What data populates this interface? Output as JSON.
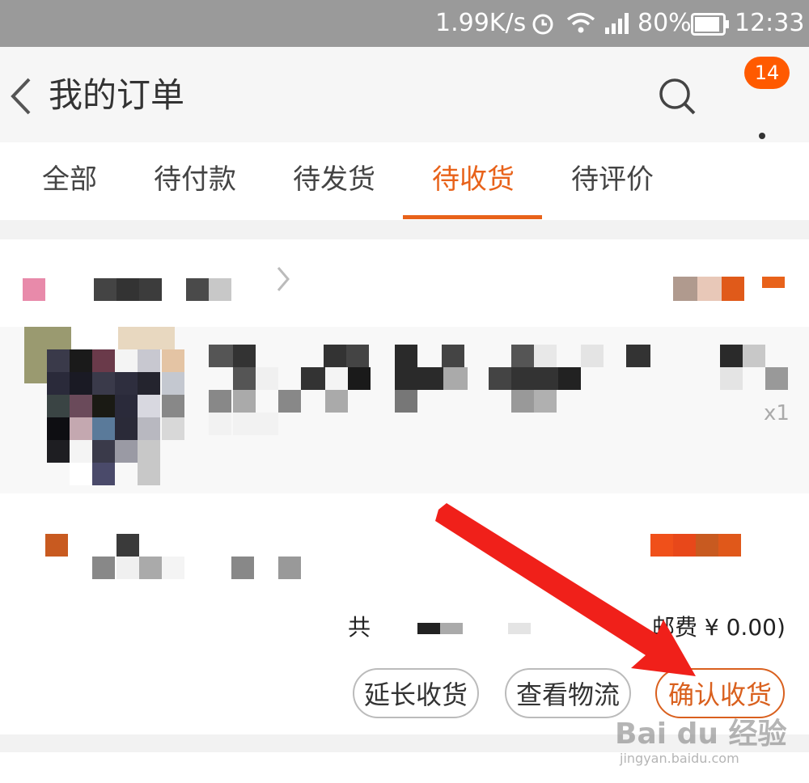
{
  "status_bar": {
    "network_speed": "1.99K/s",
    "battery": "80%",
    "time": "12:33"
  },
  "header": {
    "title": "我的订单",
    "badge_count": "14"
  },
  "tabs": [
    {
      "label": "全部",
      "active": false
    },
    {
      "label": "待付款",
      "active": false
    },
    {
      "label": "待发货",
      "active": false
    },
    {
      "label": "待收货",
      "active": true
    },
    {
      "label": "待评价",
      "active": false
    }
  ],
  "order": {
    "quantity": "x1",
    "summary_prefix": "共",
    "summary_tail": "邮费 ¥ 0.00)",
    "buttons": {
      "extend": "延长收货",
      "logistics": "查看物流",
      "confirm": "确认收货"
    }
  },
  "watermark": {
    "logo": "Bai du 经验",
    "url": "jingyan.baidu.com"
  },
  "colors": {
    "accent": "#e8621a",
    "status_bar": "#9a9a9a",
    "arrow": "#f0201a"
  }
}
